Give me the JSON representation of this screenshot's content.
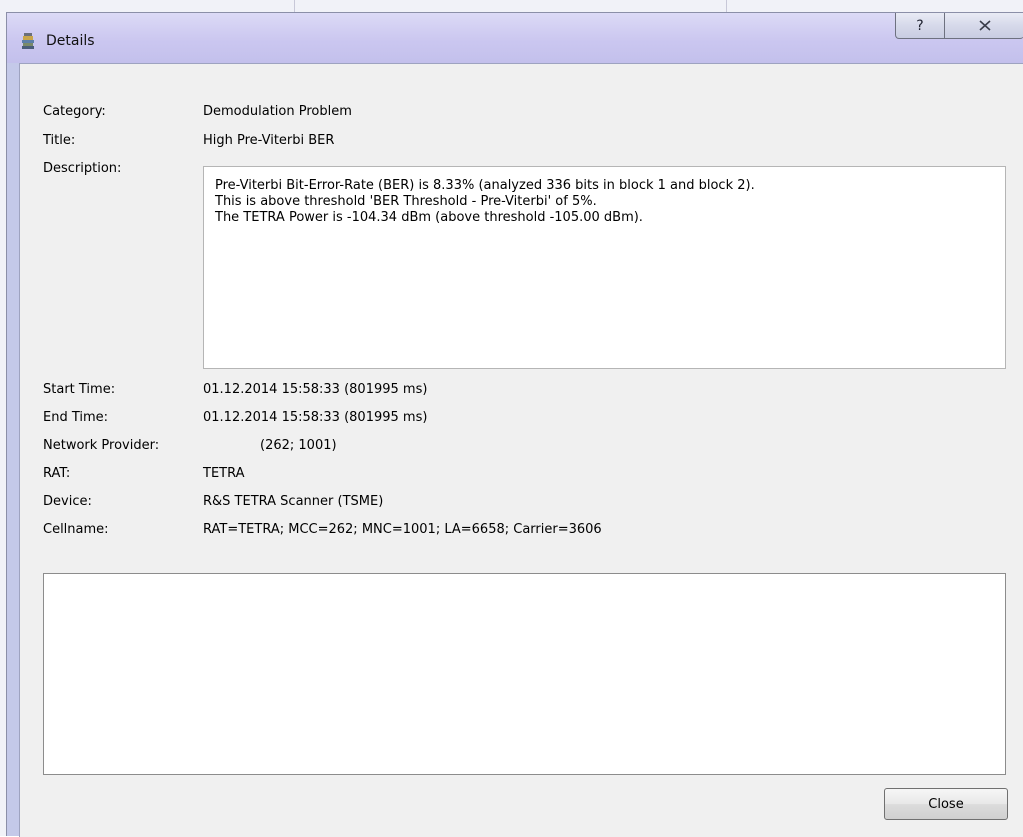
{
  "window": {
    "title": "Details",
    "help_label": "?",
    "close_icon": "close-icon"
  },
  "fields": {
    "category": {
      "label": "Category:",
      "value": "Demodulation Problem"
    },
    "title": {
      "label": "Title:",
      "value": "High Pre-Viterbi BER"
    },
    "description": {
      "label": "Description:",
      "lines": [
        "Pre-Viterbi Bit-Error-Rate (BER) is 8.33% (analyzed 336 bits in block 1 and block 2).",
        "This is above threshold 'BER Threshold - Pre-Viterbi' of 5%.",
        "The TETRA Power is -104.34 dBm (above threshold -105.00 dBm)."
      ]
    },
    "start_time": {
      "label": "Start Time:",
      "value": "01.12.2014 15:58:33 (801995 ms)"
    },
    "end_time": {
      "label": "End Time:",
      "value": "01.12.2014 15:58:33 (801995 ms)"
    },
    "network_provider": {
      "label": "Network Provider:",
      "value": "(262; 1001)"
    },
    "rat": {
      "label": "RAT:",
      "value": "TETRA"
    },
    "device": {
      "label": "Device:",
      "value": "R&S TETRA Scanner (TSME)"
    },
    "cellname": {
      "label": "Cellname:",
      "value": "RAT=TETRA; MCC=262; MNC=1001; LA=6658; Carrier=3606"
    }
  },
  "notes": {
    "value": ""
  },
  "buttons": {
    "close_label": "Close"
  }
}
